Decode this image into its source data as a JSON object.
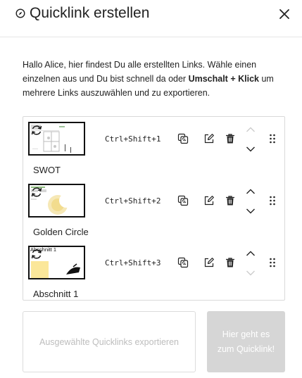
{
  "header": {
    "title": "Quicklink erstellen",
    "icon": "compass-icon",
    "close_icon": "close-icon"
  },
  "intro": {
    "text_before": "Hallo Alice, hier findest Du alle erstellten Links. Wähle einen einzelnen aus und Du bist schnell da oder ",
    "bold": "Umschalt + Klick",
    "text_after": " um mehrere Links auszuwählen und zu exportieren."
  },
  "quicklinks": [
    {
      "name": "SWOT",
      "shortcut": "Ctrl+Shift+1",
      "thumb_label": "",
      "up_enabled": false,
      "down_enabled": true
    },
    {
      "name": "Golden Circle",
      "shortcut": "Ctrl+Shift+2",
      "thumb_label": "",
      "up_enabled": true,
      "down_enabled": true
    },
    {
      "name": "Abschnitt 1",
      "shortcut": "Ctrl+Shift+3",
      "thumb_label": "Abschnitt 1",
      "up_enabled": true,
      "down_enabled": false
    }
  ],
  "buttons": {
    "export_label": "Ausgewählte Quicklinks exportieren",
    "go_label": "Hier geht es zum Quicklink!"
  },
  "colors": {
    "enabled_icon": "#222222",
    "disabled_icon": "#cccccc",
    "go_button_bg": "#d6d6d6",
    "border": "#d9d9d9"
  }
}
